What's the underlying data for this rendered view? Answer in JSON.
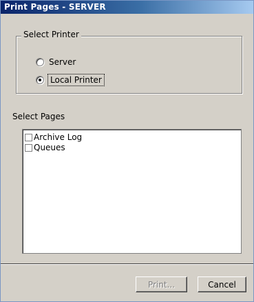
{
  "window": {
    "title": "Print Pages - SERVER"
  },
  "select_printer": {
    "legend": "Select Printer",
    "options": [
      {
        "label": "Server",
        "checked": false
      },
      {
        "label": "Local Printer",
        "checked": true
      }
    ]
  },
  "select_pages": {
    "label": "Select Pages",
    "items": [
      {
        "label": "Archive Log",
        "checked": false
      },
      {
        "label": "Queues",
        "checked": false
      }
    ]
  },
  "buttons": {
    "print_label": "Print...",
    "print_enabled": false,
    "cancel_label": "Cancel"
  },
  "colors": {
    "title_bar_start": "#0a246a",
    "title_bar_end": "#a6caf0",
    "face": "#d4d0c8"
  }
}
